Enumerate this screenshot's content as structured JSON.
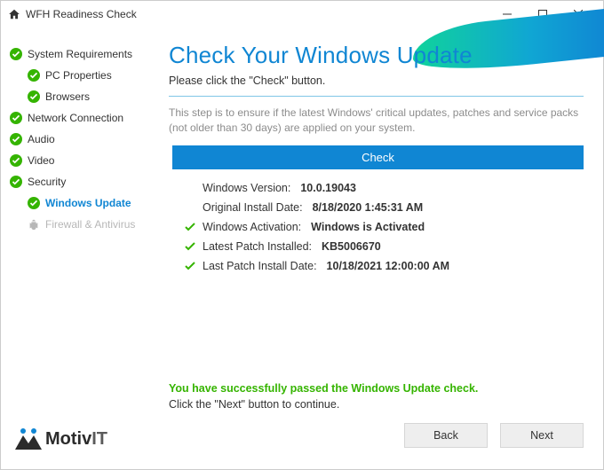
{
  "window": {
    "title": "WFH Readiness Check"
  },
  "sidebar": {
    "items": [
      {
        "label": "System Requirements"
      },
      {
        "label": "PC Properties"
      },
      {
        "label": "Browsers"
      },
      {
        "label": "Network Connection"
      },
      {
        "label": "Audio"
      },
      {
        "label": "Video"
      },
      {
        "label": "Security"
      },
      {
        "label": "Windows Update"
      },
      {
        "label": "Firewall & Antivirus"
      }
    ]
  },
  "logo": {
    "text1": "Motiv",
    "text2": "IT"
  },
  "main": {
    "heading": "Check Your Windows Update",
    "lead": "Please click the \"Check\" button.",
    "description": "This step is to ensure if the latest Windows' critical updates, patches and service packs (not older than 30 days) are applied on your system.",
    "check_label": "Check",
    "results": [
      {
        "label": "Windows Version:",
        "value": "10.0.19043",
        "tick": false
      },
      {
        "label": "Original Install Date:",
        "value": "8/18/2020 1:45:31 AM",
        "tick": false
      },
      {
        "label": "Windows Activation:",
        "value": "Windows is Activated",
        "tick": true
      },
      {
        "label": "Latest Patch Installed:",
        "value": "KB5006670",
        "tick": true
      },
      {
        "label": "Last Patch Install Date:",
        "value": "10/18/2021 12:00:00 AM",
        "tick": true
      }
    ],
    "pass_message": "You have successfully passed the Windows Update check.",
    "next_message": "Click the \"Next\" button to continue."
  },
  "footer": {
    "back": "Back",
    "next": "Next"
  }
}
